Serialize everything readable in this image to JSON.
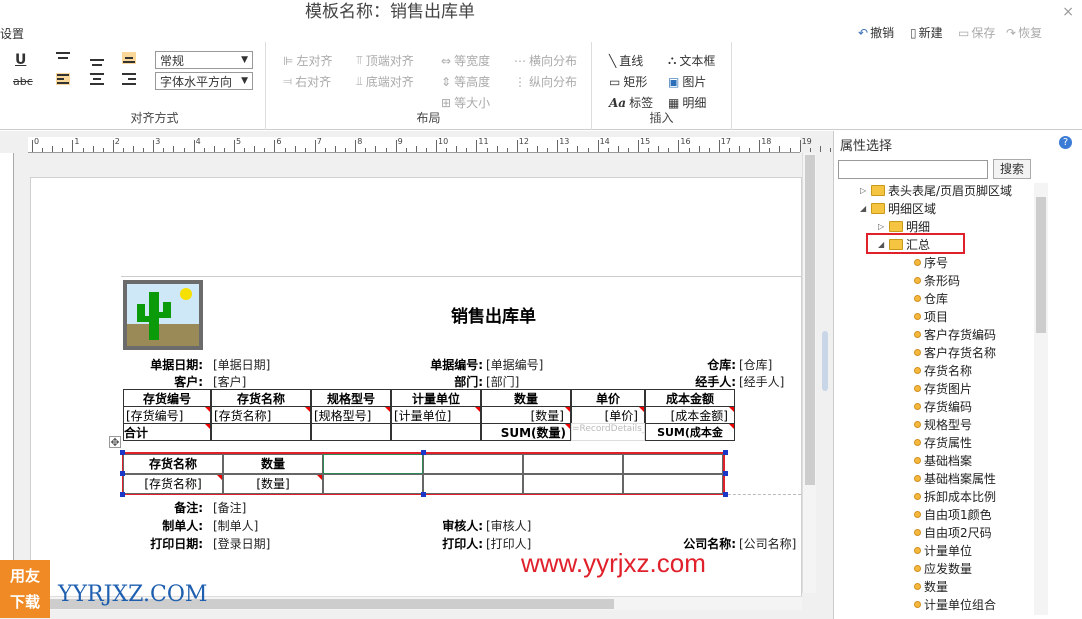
{
  "window": {
    "title": "模板名称：销售出库单",
    "close_glyph": "×"
  },
  "toolbar": {
    "settings_label": "设置",
    "undo": "撤销",
    "new": "新建",
    "save": "保存",
    "redo": "恢复"
  },
  "ribbon": {
    "font_size_select": "常规",
    "font_align_select": "字体水平方向",
    "align_group_title": "对齐方式",
    "layout": {
      "left_align": "左对齐",
      "right_align": "右对齐",
      "top_align": "顶端对齐",
      "bottom_align": "底端对齐",
      "same_width": "等宽度",
      "same_height": "等高度",
      "same_size": "等大小",
      "h_distribute": "横向分布",
      "v_distribute": "纵向分布",
      "title": "布局"
    },
    "insert": {
      "line": "直线",
      "textbox": "文本框",
      "rect": "矩形",
      "image": "图片",
      "label": "标签",
      "detail": "明细",
      "title": "插入"
    }
  },
  "ruler": {
    "labels": [
      "0",
      "1",
      "2",
      "3",
      "4",
      "5",
      "6",
      "7",
      "8",
      "9",
      "10",
      "11",
      "12",
      "13",
      "14",
      "15",
      "16",
      "17",
      "18",
      "19"
    ]
  },
  "report": {
    "title": "销售出库单",
    "row1": {
      "l1": "单据日期:",
      "v1": "[单据日期]",
      "l2": "单据编号:",
      "v2": "[单据编号]",
      "l3": "仓库:",
      "v3": "[仓库]"
    },
    "row2": {
      "l1": "客户:",
      "v1": "[客户]",
      "l2": "部门:",
      "v2": "[部门]",
      "l3": "经手人:",
      "v3": "[经手人]"
    },
    "detail_headers": [
      "存货编号",
      "存货名称",
      "规格型号",
      "计量单位",
      "数量",
      "单价",
      "成本金额"
    ],
    "detail_values": [
      "[存货编号]",
      "[存货名称]",
      "[规格型号]",
      "[计量单位]",
      "[数量]",
      "[单价]",
      "[成本金额]"
    ],
    "total_row": {
      "label": "合计",
      "sum_qty": "SUM(数量)",
      "sum_cost": "SUM(成本金",
      "ghost": "=RecordDetails_Sum](Tab0]"
    },
    "summary_headers": [
      "存货名称",
      "数量"
    ],
    "summary_values": [
      "[存货名称]",
      "[数量]"
    ],
    "remarks": {
      "label": "备注:",
      "value": "[备注]"
    },
    "row_maker": {
      "l1": "制单人:",
      "v1": "[制单人]",
      "l2": "审核人:",
      "v2": "[审核人]"
    },
    "row_print": {
      "l1": "打印日期:",
      "v1": "[登录日期]",
      "l2": "打印人:",
      "v2": "[打印人]",
      "l3": "公司名称:",
      "v3": "[公司名称]"
    }
  },
  "prop_panel": {
    "title": "属性选择",
    "help": "?",
    "search_button": "搜索",
    "tree": [
      {
        "label": "表头表尾/页眉页脚区域",
        "type": "folder",
        "expand": "▷"
      },
      {
        "label": "明细区域",
        "type": "folder",
        "expand": "◢"
      },
      {
        "label": "明细",
        "type": "folder",
        "expand": "▷"
      },
      {
        "label": "汇总",
        "type": "folder",
        "expand": "◢"
      },
      {
        "label": "序号",
        "type": "field"
      },
      {
        "label": "条形码",
        "type": "field"
      },
      {
        "label": "仓库",
        "type": "field"
      },
      {
        "label": "项目",
        "type": "field"
      },
      {
        "label": "客户存货编码",
        "type": "field"
      },
      {
        "label": "客户存货名称",
        "type": "field"
      },
      {
        "label": "存货名称",
        "type": "field"
      },
      {
        "label": "存货图片",
        "type": "field"
      },
      {
        "label": "存货编码",
        "type": "field"
      },
      {
        "label": "规格型号",
        "type": "field"
      },
      {
        "label": "存货属性",
        "type": "field"
      },
      {
        "label": "基础档案",
        "type": "field"
      },
      {
        "label": "基础档案属性",
        "type": "field"
      },
      {
        "label": "拆卸成本比例",
        "type": "field"
      },
      {
        "label": "自由项1颜色",
        "type": "field"
      },
      {
        "label": "自由项2尺码",
        "type": "field"
      },
      {
        "label": "计量单位",
        "type": "field"
      },
      {
        "label": "应发数量",
        "type": "field"
      },
      {
        "label": "数量",
        "type": "field"
      },
      {
        "label": "计量单位组合",
        "type": "field"
      }
    ]
  },
  "watermark": {
    "logo_top": "用友",
    "logo_bottom": "下载",
    "site_name": "YYRJXZ.COM",
    "url": "www.yyrjxz.com"
  },
  "colors": {
    "highlight_red": "#e0202a",
    "handle_blue": "#1a37c8",
    "folder_yellow": "#f5c542"
  }
}
